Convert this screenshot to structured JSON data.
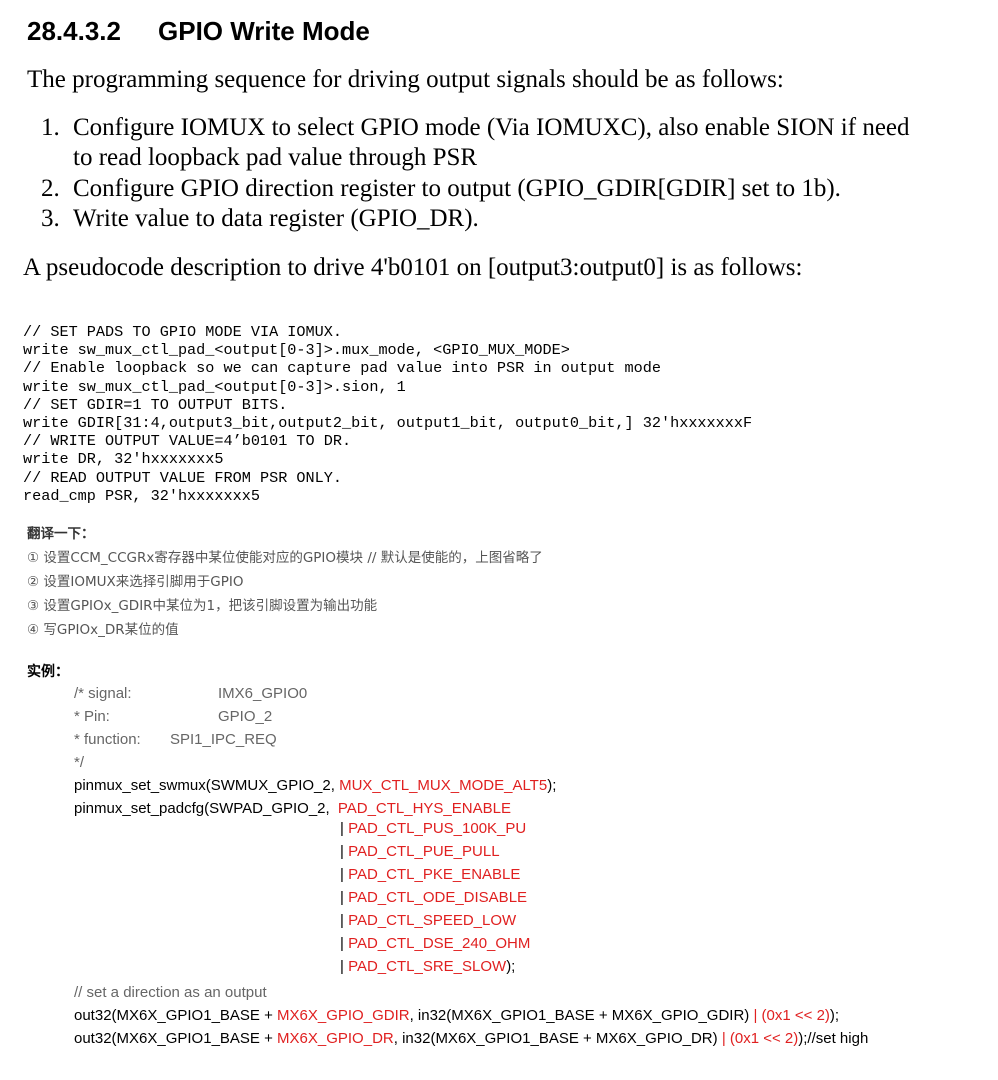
{
  "heading": {
    "number": "28.4.3.2",
    "title": "GPIO Write Mode"
  },
  "intro": "The programming sequence for driving output signals should be as follows:",
  "steps": [
    {
      "num": "1.",
      "line1": "Configure IOMUX to select GPIO mode (Via IOMUXC), also enable SION if need",
      "line2": "to read loopback pad value through PSR"
    },
    {
      "num": "2.",
      "line1": "Configure GPIO direction register to output (GPIO_GDIR[GDIR] set to 1b)."
    },
    {
      "num": "3.",
      "line1": "Write value to data register (GPIO_DR)."
    }
  ],
  "pseudocode_intro": "A pseudocode description to drive 4'b0101 on [output3:output0] is as follows:",
  "code_lines": [
    "// SET PADS TO GPIO MODE VIA IOMUX.",
    "write sw_mux_ctl_pad_<output[0-3]>.mux_mode, <GPIO_MUX_MODE>",
    "// Enable loopback so we can capture pad value into PSR in output mode",
    "write sw_mux_ctl_pad_<output[0-3]>.sion, 1",
    "// SET GDIR=1 TO OUTPUT BITS.",
    "write GDIR[31:4,output3_bit,output2_bit, output1_bit, output0_bit,] 32'hxxxxxxxF",
    "// WRITE OUTPUT VALUE=4’b0101 TO DR.",
    "write DR, 32'hxxxxxxx5",
    "// READ OUTPUT VALUE FROM PSR ONLY.",
    "read_cmp PSR, 32'hxxxxxxx5"
  ],
  "translation": {
    "title": "翻译一下：",
    "items": [
      "① 设置CCM_CCGRx寄存器中某位使能对应的GPIO模块 // 默认是使能的，上图省略了",
      "② 设置IOMUX来选择引脚用于GPIO",
      "③ 设置GPIOx_GDIR中某位为1，把该引脚设置为输出功能",
      "④ 写GPIOx_DR某位的值"
    ]
  },
  "example": {
    "title": "实例：",
    "comment": {
      "open": "/* signal:",
      "signal_value": "IMX6_GPIO0",
      "pin_label": " * Pin:",
      "pin_value": "GPIO_2",
      "function_label": " * function:",
      "function_value": "SPI1_IPC_REQ",
      "close": " */"
    },
    "swmux": {
      "prefix": "pinmux_set_swmux(SWMUX_GPIO_2, ",
      "value": "MUX_CTL_MUX_MODE_ALT5",
      "suffix": ");"
    },
    "padcfg": {
      "prefix": "pinmux_set_padcfg(SWPAD_GPIO_2, ",
      "first_flag": "PAD_CTL_HYS_ENABLE",
      "flags": [
        "PAD_CTL_PUS_100K_PU",
        "PAD_CTL_PUE_PULL",
        "PAD_CTL_PKE_ENABLE",
        "PAD_CTL_ODE_DISABLE",
        "PAD_CTL_SPEED_LOW",
        "PAD_CTL_DSE_240_OHM",
        "PAD_CTL_SRE_SLOW"
      ],
      "separator": "| ",
      "end": ");"
    },
    "direction_comment": "// set a direction as an output",
    "out1": {
      "a": "out32(MX6X_GPIO1_BASE + ",
      "b": "MX6X_GPIO_GDIR",
      "c": ", in32(MX6X_GPIO1_BASE + MX6X_GPIO_GDIR) ",
      "d": "| (0x1 << 2)",
      "e": ");"
    },
    "out2": {
      "a": "out32(MX6X_GPIO1_BASE + ",
      "b": "MX6X_GPIO_DR",
      "c": ", in32(MX6X_GPIO1_BASE + MX6X_GPIO_DR) ",
      "d": "| (0x1 << 2)",
      "e": ");//set high"
    }
  }
}
